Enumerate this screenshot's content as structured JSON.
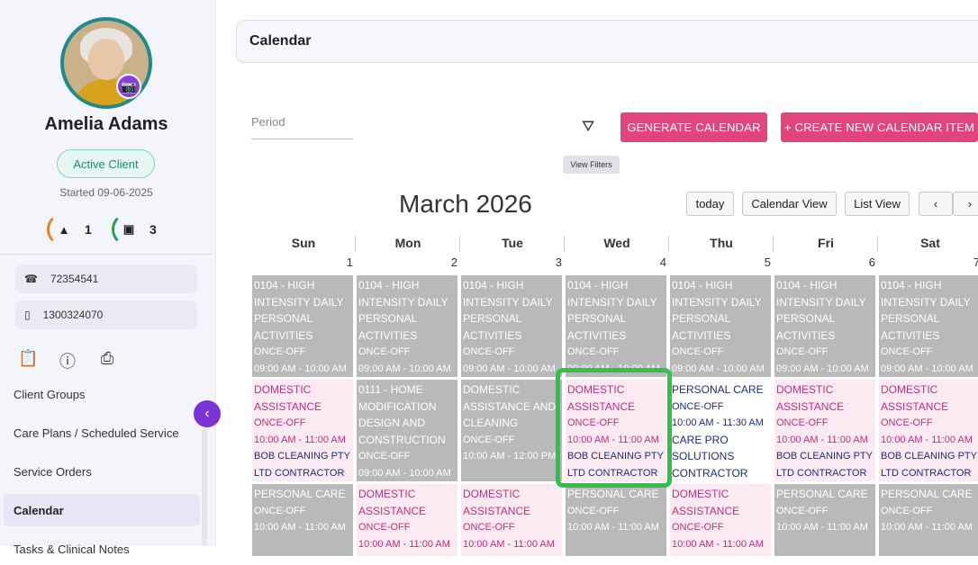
{
  "client": {
    "name": "Amelia Adams",
    "status": "Active Client",
    "started": "Started 09-06-2025",
    "alert_count": "1",
    "wallet_count": "3",
    "phone": "72354541",
    "mobile": "1300324070"
  },
  "icons": {
    "camera": "📷",
    "warning": "▲",
    "wallet": "▣",
    "phone": "☎",
    "mobile": "▯",
    "clipboard": "📋",
    "info": "ⓘ",
    "print": "⎙",
    "collapse": "‹",
    "filter": "⛛",
    "prev": "‹",
    "next": "›"
  },
  "nav": {
    "items": [
      {
        "label": "Client Groups"
      },
      {
        "label": "Care Plans / Scheduled Service"
      },
      {
        "label": "Service Orders"
      },
      {
        "label": "Calendar"
      },
      {
        "label": "Tasks & Clinical Notes"
      }
    ]
  },
  "header": {
    "title": "Calendar"
  },
  "toolbar": {
    "period_placeholder": "Period",
    "filter_tooltip": "View Filters",
    "generate_label": "GENERATE CALENDAR",
    "create_label": "+ CREATE NEW CALENDAR ITEM"
  },
  "calendar": {
    "month": "March 2026",
    "today_label": "today",
    "calendar_view_label": "Calendar View",
    "list_view_label": "List View",
    "days": [
      {
        "name": "Sun",
        "num": "1"
      },
      {
        "name": "Mon",
        "num": "2"
      },
      {
        "name": "Tue",
        "num": "3"
      },
      {
        "name": "Wed",
        "num": "4"
      },
      {
        "name": "Thu",
        "num": "5"
      },
      {
        "name": "Fri",
        "num": "6"
      },
      {
        "name": "Sat",
        "num": "7"
      }
    ],
    "row1": [
      {
        "title": "0104 - HIGH INTENSITY DAILY PERSONAL ACTIVITIES",
        "freq": "ONCE-OFF",
        "time": "09:00 AM - 10:00 AM"
      },
      {
        "title": "0104 - HIGH INTENSITY DAILY PERSONAL ACTIVITIES",
        "freq": "ONCE-OFF",
        "time": "09:00 AM - 10:00 AM"
      },
      {
        "title": "0104 - HIGH INTENSITY DAILY PERSONAL ACTIVITIES",
        "freq": "ONCE-OFF",
        "time": "09:00 AM - 10:00 AM"
      },
      {
        "title": "0104 - HIGH INTENSITY DAILY PERSONAL ACTIVITIES",
        "freq": "ONCE-OFF",
        "time": "09:00 AM - 10:00 AM"
      },
      {
        "title": "0104 - HIGH INTENSITY DAILY PERSONAL ACTIVITIES",
        "freq": "ONCE-OFF",
        "time": "09:00 AM - 10:00 AM"
      },
      {
        "title": "0104 - HIGH INTENSITY DAILY PERSONAL ACTIVITIES",
        "freq": "ONCE-OFF",
        "time": "09:00 AM - 10:00 AM"
      },
      {
        "title": "0104 - HIGH INTENSITY DAILY PERSONAL ACTIVITIES",
        "freq": "ONCE-OFF",
        "time": "09:00 AM - 10:00 AM"
      }
    ],
    "row2": [
      {
        "title": "DOMESTIC ASSISTANCE",
        "freq": "ONCE-OFF",
        "time": "10:00 AM - 11:00 AM",
        "provider": "BOB CLEANING PTY LTD CONTRACTOR"
      },
      {
        "title": "0111 - HOME MODIFICATION DESIGN AND CONSTRUCTION",
        "freq": "ONCE-OFF",
        "time": "09:00 AM - 10:00 AM"
      },
      {
        "title": "DOMESTIC ASSISTANCE AND CLEANING",
        "freq": "ONCE-OFF",
        "time": "10:00 AM - 12:00 PM"
      },
      {
        "title": "DOMESTIC ASSISTANCE",
        "freq": "ONCE-OFF",
        "time": "10:00 AM - 11:00 AM",
        "provider": "BOB CLEANING PTY LTD CONTRACTOR"
      },
      {
        "title": "PERSONAL CARE",
        "freq": "ONCE-OFF",
        "time": "10:00 AM - 11:30 AM",
        "provider": "CARE PRO SOLUTIONS CONTRACTOR"
      },
      {
        "title": "DOMESTIC ASSISTANCE",
        "freq": "ONCE-OFF",
        "time": "10:00 AM - 11:00 AM",
        "provider": "BOB CLEANING PTY LTD CONTRACTOR"
      },
      {
        "title": "DOMESTIC ASSISTANCE",
        "freq": "ONCE-OFF",
        "time": "10:00 AM - 11:00 AM",
        "provider": "BOB CLEANING PTY LTD CONTRACTOR"
      }
    ],
    "row3": [
      {
        "title": "PERSONAL CARE",
        "freq": "ONCE-OFF",
        "time": "10:00 AM - 11:00 AM"
      },
      {
        "title": "DOMESTIC ASSISTANCE",
        "freq": "ONCE-OFF",
        "time": "10:00 AM - 11:00 AM"
      },
      {
        "title": "DOMESTIC ASSISTANCE",
        "freq": "ONCE-OFF",
        "time": "10:00 AM - 11:00 AM"
      },
      {
        "title": "PERSONAL CARE",
        "freq": "ONCE-OFF",
        "time": "10:00 AM - 11:00 AM"
      },
      {
        "title": "DOMESTIC ASSISTANCE",
        "freq": "ONCE-OFF",
        "time": "10:00 AM - 11:00 AM"
      },
      {
        "title": "PERSONAL CARE",
        "freq": "ONCE-OFF",
        "time": "10:00 AM - 11:00 AM"
      },
      {
        "title": "PERSONAL CARE",
        "freq": "ONCE-OFF",
        "time": "10:00 AM - 11:00 AM"
      }
    ]
  },
  "colors": {
    "accent_pink": "#e1457c",
    "purple": "#7b33d6",
    "teal": "#1f8a8a",
    "highlight_green": "#2ec24a"
  }
}
